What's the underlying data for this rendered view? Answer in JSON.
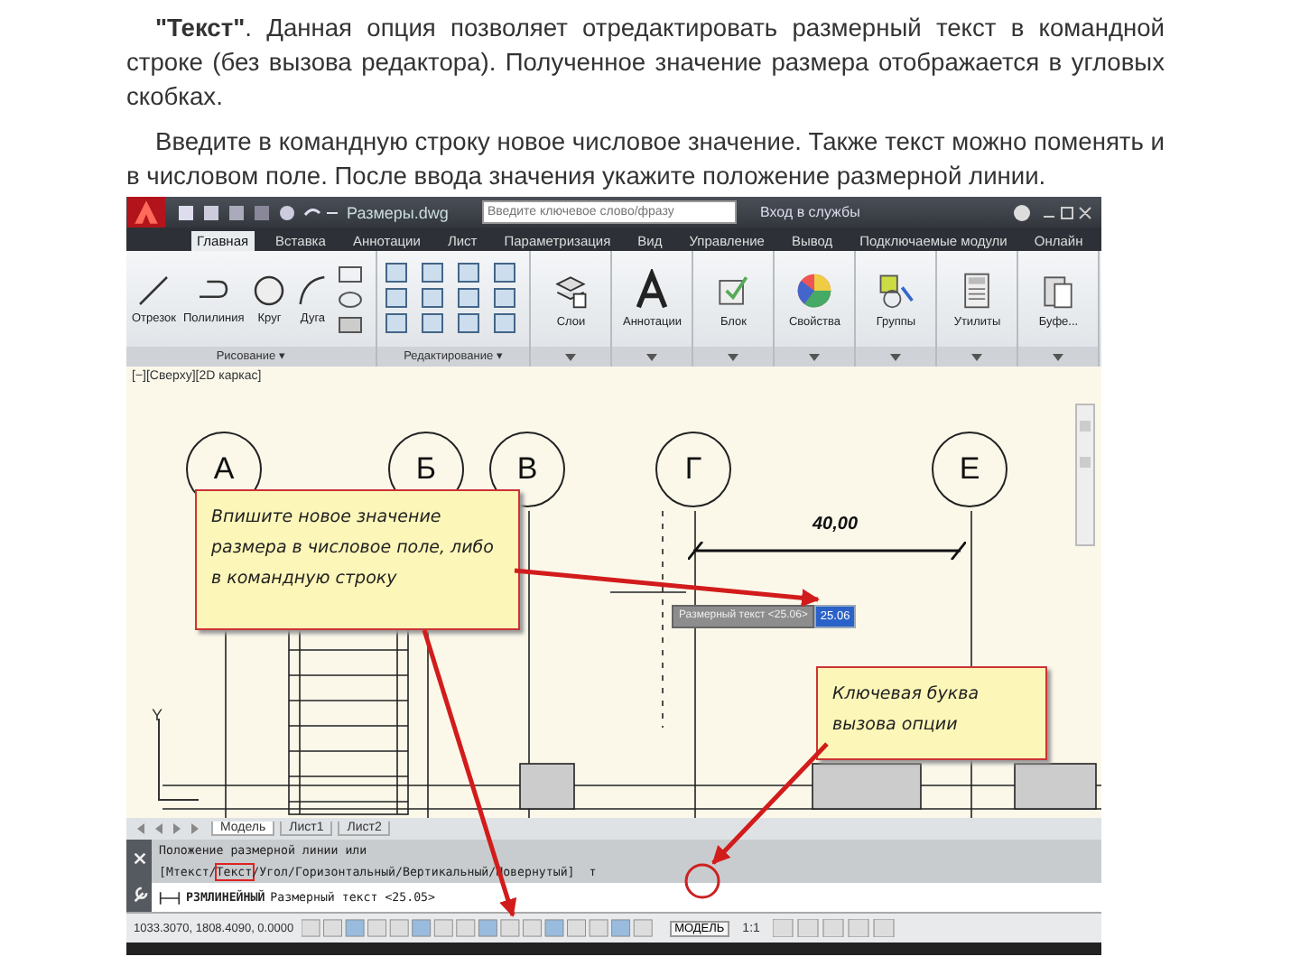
{
  "article": {
    "paragraphs": [
      "**\"Текст\"**. Данная опция позволяет отредактировать размерный текст в командной строке (без вызова редактора). Полученное значение размера отображается в угловых скобках.",
      "Введите в командную строку новое числовое значение. Также текст можно поменять и в числовом поле. После ввода значения укажите положение размерной линии."
    ]
  },
  "cad": {
    "title_bar": {
      "file_name": "Размеры.dwg",
      "search_placeholder": "Введите ключевое слово/фразу",
      "sign_in": "Вход в службы"
    },
    "ribbon_tabs": [
      {
        "label": "Главная",
        "selected": true
      },
      {
        "label": "Вставка",
        "selected": false
      },
      {
        "label": "Аннотации",
        "selected": false
      },
      {
        "label": "Лист",
        "selected": false
      },
      {
        "label": "Параметризация",
        "selected": false
      },
      {
        "label": "Вид",
        "selected": false
      },
      {
        "label": "Управление",
        "selected": false
      },
      {
        "label": "Вывод",
        "selected": false
      },
      {
        "label": "Подключаемые модули",
        "selected": false
      },
      {
        "label": "Онлайн",
        "selected": false
      }
    ],
    "draw_tools": [
      {
        "label": "Отрезок",
        "kind": "line"
      },
      {
        "label": "Полилиния",
        "kind": "polyline"
      },
      {
        "label": "Круг",
        "kind": "circle"
      },
      {
        "label": "Дуга",
        "kind": "arc"
      }
    ],
    "big_tools": [
      {
        "label": "Слои",
        "kind": "layers"
      },
      {
        "label": "Аннотации",
        "kind": "text"
      },
      {
        "label": "Блок",
        "kind": "block"
      },
      {
        "label": "Свойства",
        "kind": "palette"
      },
      {
        "label": "Группы",
        "kind": "group"
      },
      {
        "label": "Утилиты",
        "kind": "calculator"
      },
      {
        "label": "Буфе...",
        "kind": "clipboard"
      }
    ],
    "panels": [
      "Рисование ▾",
      "Редактирование ▾"
    ],
    "viewport": {
      "label": "[−][Сверху][2D каркас]",
      "grid_bubbles": [
        "А",
        "Б",
        "В",
        "Г",
        "Е"
      ],
      "dimension": "40,00",
      "ucs_label": "Y",
      "dynamic_input": {
        "label": "Размерный текст <25.06>",
        "value": "25.06"
      },
      "callouts": [
        "Впишите новое значение размера в числовое поле, либо в командную строку",
        "Ключевая буква вызова опции"
      ]
    },
    "layout_tabs": [
      {
        "label": "Модель",
        "selected": true
      },
      {
        "label": "Лист1",
        "selected": false
      },
      {
        "label": "Лист2",
        "selected": false
      }
    ],
    "command": {
      "history": "Положение размерной линии или",
      "options": [
        {
          "text": "[Мтекст/",
          "highlighted": false
        },
        {
          "text": "Текст",
          "highlighted": true
        },
        {
          "text": "/Угол/Горизонтальный/Вертикальный/Повернутый]",
          "highlighted": false
        }
      ],
      "typed": "т",
      "prompt_command": "РЗМЛИНЕЙНЫЙ",
      "prompt_text": "Размерный текст <25.05>"
    },
    "status_bar": {
      "coordinates": "1033.3070, 1808.4090, 0.0000",
      "space": "МОДЕЛЬ",
      "scale": "1:1"
    }
  }
}
